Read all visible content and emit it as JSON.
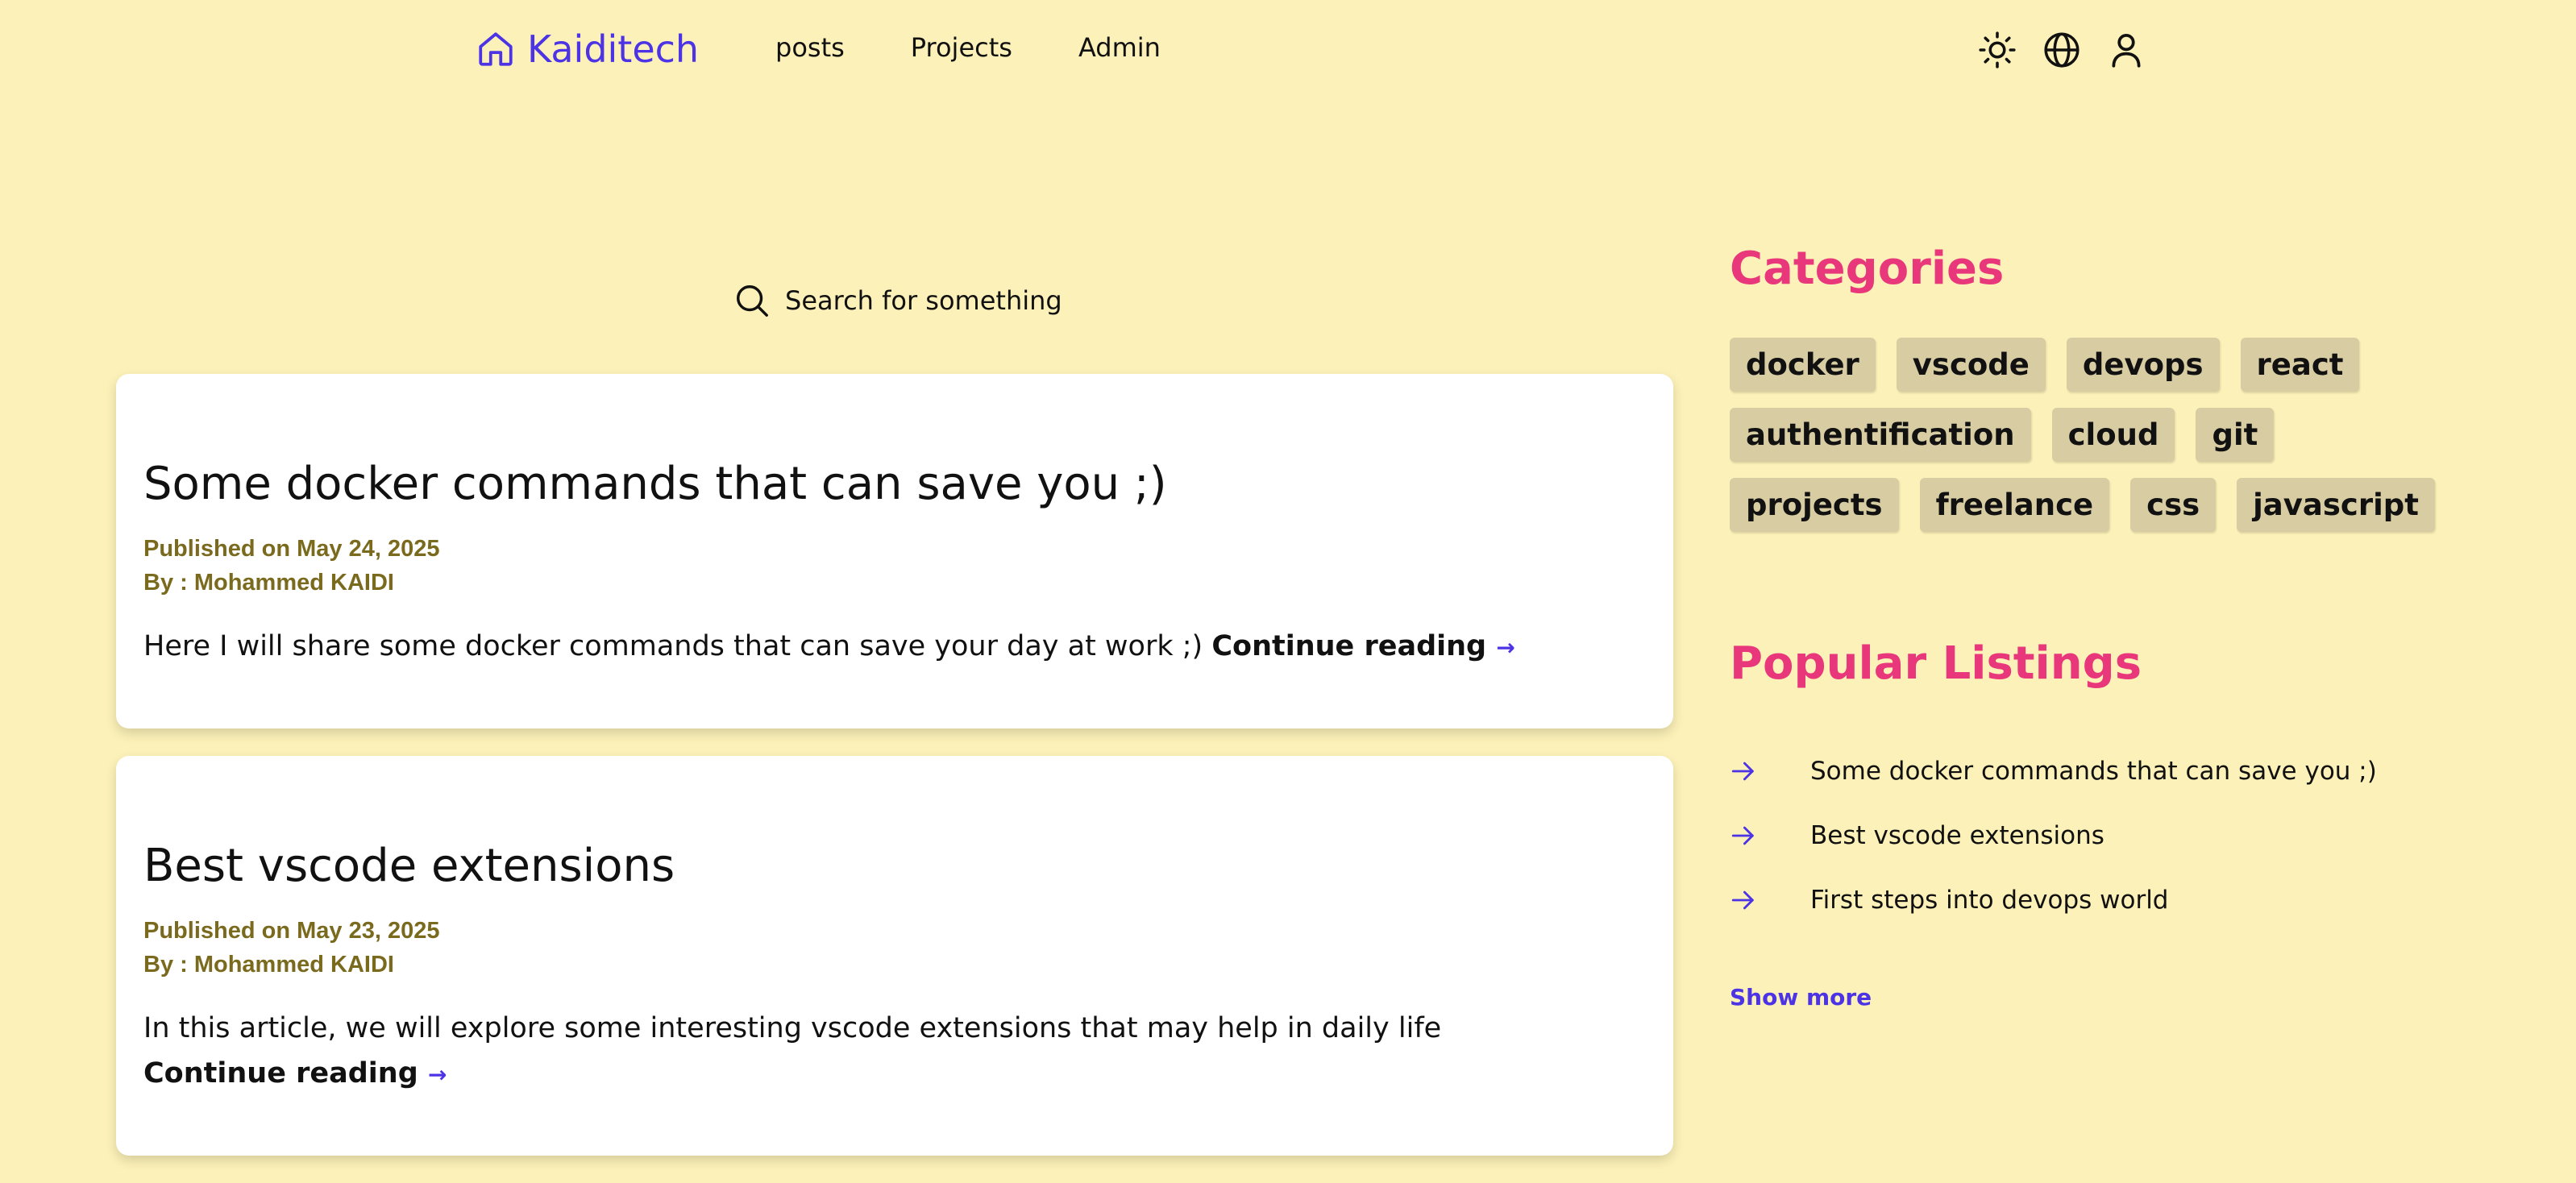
{
  "header": {
    "brand": "Kaiditech",
    "brand_icon": "home-icon",
    "nav": [
      "posts",
      "Projects",
      "Admin"
    ],
    "icons": [
      "sun-icon",
      "globe-icon",
      "user-icon"
    ]
  },
  "search": {
    "placeholder": "Search for something",
    "icon": "search-icon"
  },
  "posts": [
    {
      "title": "Some docker commands that can save you ;)",
      "published": "Published on May 24, 2025",
      "author": "By : Mohammed KAIDI",
      "excerpt": "Here I will share some docker commands that can save your day at work ;)",
      "continue_label": "Continue reading",
      "arrow": "→"
    },
    {
      "title": "Best vscode extensions",
      "published": "Published on May 23, 2025",
      "author": "By : Mohammed KAIDI",
      "excerpt": "In this article, we will explore some interesting vscode extensions that may help in daily life",
      "continue_label": "Continue reading",
      "arrow": "→"
    }
  ],
  "sidebar": {
    "categories_title": "Categories",
    "categories": [
      "docker",
      "vscode",
      "devops",
      "react",
      "authentification",
      "cloud",
      "git",
      "projects",
      "freelance",
      "css",
      "javascript"
    ],
    "popular_title": "Popular Listings",
    "popular": [
      "Some docker commands that can save you ;)",
      "Best vscode extensions",
      "First steps into devops world"
    ],
    "show_more": "Show more"
  },
  "colors": {
    "background": "#fcf1b8",
    "brand": "#4c33e6",
    "accent_pink": "#e8387b",
    "meta": "#7a6a1e",
    "tag_bg": "#d8cca3",
    "card_bg": "#ffffff"
  }
}
